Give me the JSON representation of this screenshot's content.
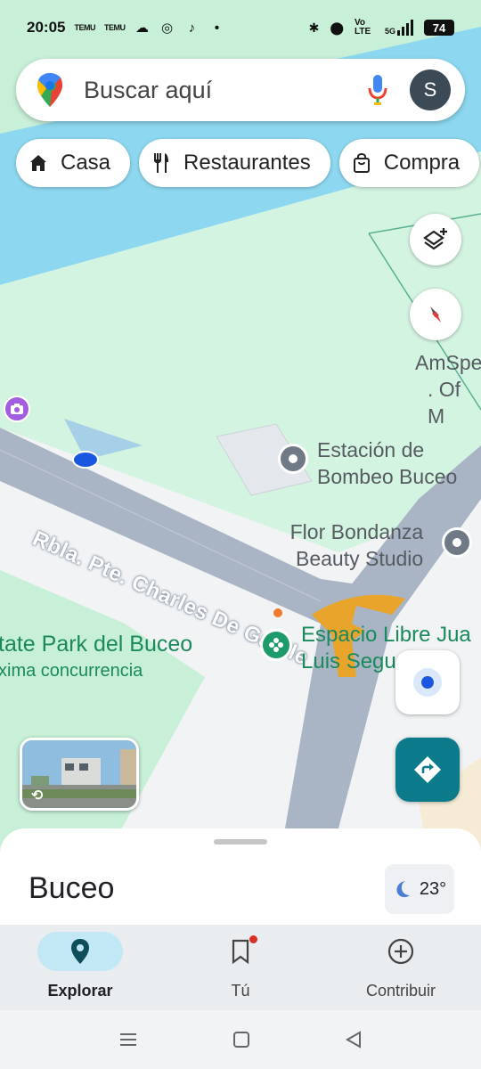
{
  "status": {
    "time": "20:05",
    "temu1": "TEMU",
    "temu2": "TEMU",
    "volte": "Vo LTE",
    "network": "5G",
    "battery": "74"
  },
  "search": {
    "placeholder": "Buscar aquí",
    "avatar_letter": "S"
  },
  "chips": [
    {
      "label": "Casa",
      "icon": "home-icon"
    },
    {
      "label": "Restaurantes",
      "icon": "restaurant-icon"
    },
    {
      "label": "Compra",
      "icon": "shopping-bag-icon"
    }
  ],
  "map": {
    "labels": {
      "amspe_line1": "AmSpe",
      "amspe_line2": ". Of M",
      "estacion_line1": "Estación de",
      "estacion_line2": "Bombeo Buceo",
      "flor_line1": "Flor Bondanza",
      "flor_line2": "Beauty Studio",
      "road": "Rbla. Pte. Charles De Gaulle",
      "park_line1": "tate Park del Buceo",
      "park_line2": "xima concurrencia",
      "espacio_line1": "Espacio Libre Jua",
      "espacio_line2": "Luis Segu"
    },
    "colors": {
      "water": "#8dd8f0",
      "green": "#c8f0d8",
      "road": "#a9b5c5",
      "accent": "#0b7a8a",
      "poi_gray": "#6f7a86",
      "poi_green": "#1e9b6a"
    }
  },
  "sheet": {
    "title": "Buceo",
    "weather": "23°"
  },
  "nav": {
    "explore": "Explorar",
    "you": "Tú",
    "contribute": "Contribuir"
  }
}
